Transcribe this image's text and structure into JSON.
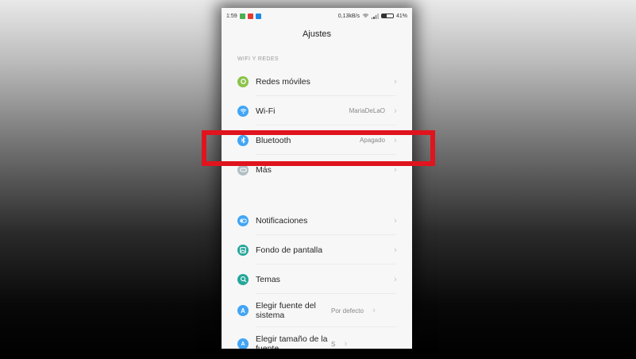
{
  "statusbar": {
    "time": "1:59",
    "app_icons": [
      {
        "name": "green-app-icon",
        "color": "#4caf50"
      },
      {
        "name": "red-app-icon",
        "color": "#e53935"
      },
      {
        "name": "blue-app-icon",
        "color": "#1e88e5"
      }
    ],
    "network_speed": "0,13kB/s",
    "battery": "41%",
    "battery_level": 0.41
  },
  "title": "Ajustes",
  "section_header": "WIFI Y REDES",
  "network_items": [
    {
      "label": "Redes móviles",
      "value": "",
      "icon": "mobile-network-icon",
      "icon_color": "#8bc34a"
    },
    {
      "label": "Wi-Fi",
      "value": "MariaDeLaO",
      "icon": "wifi-icon",
      "icon_color": "#42a5f5"
    },
    {
      "label": "Bluetooth",
      "value": "Apagado",
      "icon": "bluetooth-icon",
      "icon_color": "#42a5f5"
    },
    {
      "label": "Más",
      "value": "",
      "icon": "more-link-icon",
      "icon_color": "#b0bec5"
    }
  ],
  "personal_items": [
    {
      "label": "Notificaciones",
      "value": "",
      "icon": "notifications-icon",
      "icon_color": "#42a5f5"
    },
    {
      "label": "Fondo de pantalla",
      "value": "",
      "icon": "wallpaper-icon",
      "icon_color": "#26a69a"
    },
    {
      "label": "Temas",
      "value": "",
      "icon": "themes-icon",
      "icon_color": "#26a69a"
    },
    {
      "label": "Elegir fuente del sistema",
      "value": "Por defecto",
      "icon": "font-icon",
      "icon_color": "#42a5f5"
    },
    {
      "label": "Elegir tamaño de la fuente",
      "value": "S",
      "icon": "font-size-icon",
      "icon_color": "#42a5f5"
    }
  ],
  "highlight_color": "#e0141e"
}
